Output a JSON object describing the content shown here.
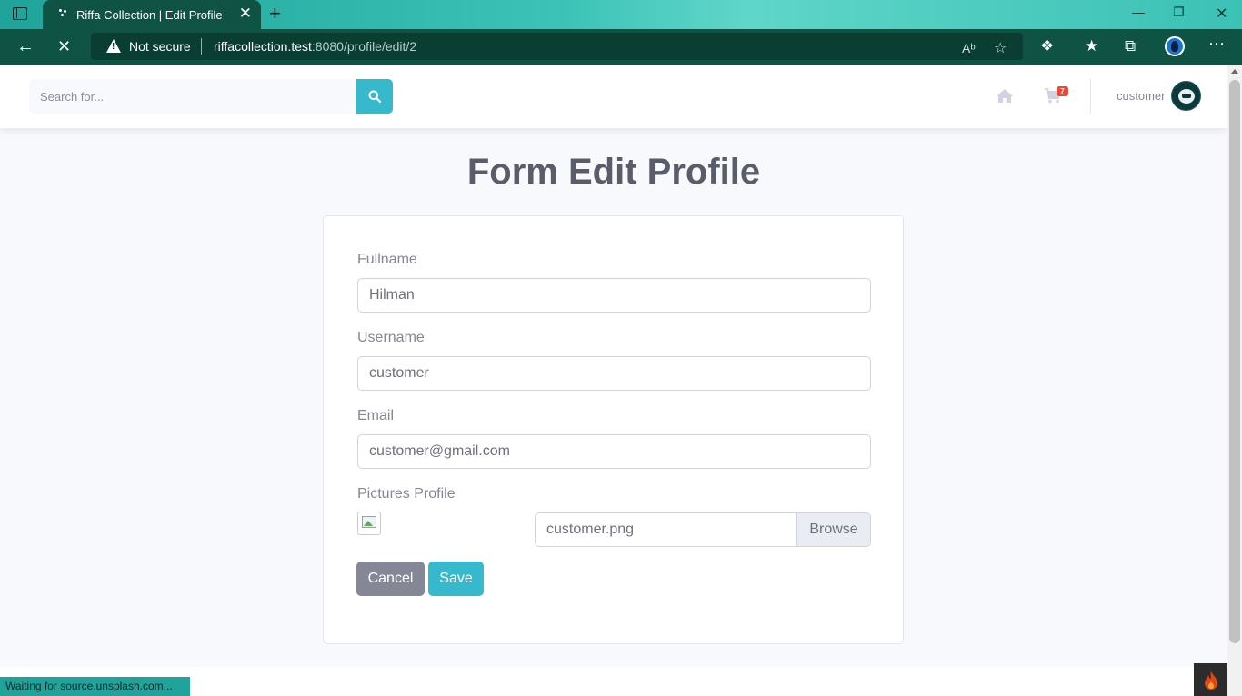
{
  "browser": {
    "tab_title": "Riffa Collection | Edit Profile",
    "tab_close": "✕",
    "new_tab": "+",
    "security_label": "Not secure",
    "url_host": "riffacollection.test",
    "url_rest": ":8080/profile/edit/2",
    "status_text": "Waiting for source.unsplash.com..."
  },
  "topbar": {
    "search_placeholder": "Search for...",
    "cart_count": "7",
    "user_name": "customer"
  },
  "page": {
    "title": "Form Edit Profile"
  },
  "form": {
    "fullname_label": "Fullname",
    "fullname_value": "Hilman",
    "username_label": "Username",
    "username_value": "customer",
    "email_label": "Email",
    "email_value": "customer@gmail.com",
    "picture_label": "Pictures Profile",
    "picture_file": "customer.png",
    "browse_label": "Browse",
    "cancel_label": "Cancel",
    "save_label": "Save"
  },
  "colors": {
    "accent": "#36b9cc",
    "secondary": "#858796",
    "browser_dark": "#0f5345",
    "badge": "#e74a3b"
  }
}
